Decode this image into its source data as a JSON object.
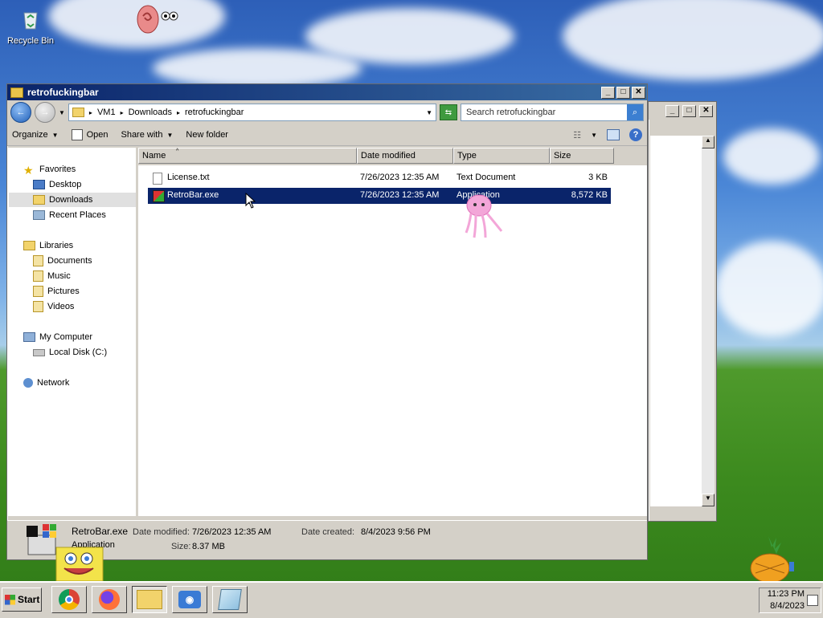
{
  "desktop": {
    "recycle_bin_label": "Recycle Bin"
  },
  "window": {
    "title": "retrofuckingbar",
    "minimize": "_",
    "maximize": "□",
    "close": "✕",
    "address": {
      "crumbs": [
        "VM1",
        "Downloads",
        "retrofuckingbar"
      ],
      "search_placeholder": "Search retrofuckingbar"
    },
    "commands": {
      "organize": "Organize",
      "open": "Open",
      "share_with": "Share with",
      "new_folder": "New folder"
    },
    "nav": {
      "favorites": "Favorites",
      "desktop": "Desktop",
      "downloads": "Downloads",
      "recent_places": "Recent Places",
      "libraries": "Libraries",
      "documents": "Documents",
      "music": "Music",
      "pictures": "Pictures",
      "videos": "Videos",
      "my_computer": "My Computer",
      "local_disk": "Local Disk (C:)",
      "network": "Network"
    },
    "columns": {
      "name": "Name",
      "date_modified": "Date modified",
      "type": "Type",
      "size": "Size"
    },
    "files": [
      {
        "name": "License.txt",
        "date": "7/26/2023 12:35 AM",
        "type": "Text Document",
        "size": "3 KB"
      },
      {
        "name": "RetroBar.exe",
        "date": "7/26/2023 12:35 AM",
        "type": "Application",
        "size": "8,572 KB"
      }
    ],
    "details": {
      "name": "RetroBar.exe",
      "kind": "Application",
      "date_modified_label": "Date modified:",
      "date_modified": "7/26/2023 12:35 AM",
      "date_created_label": "Date created:",
      "date_created": "8/4/2023 9:56 PM",
      "size_label": "Size:",
      "size": "8.37 MB"
    }
  },
  "taskbar": {
    "start_label": "Start",
    "time": "11:23 PM",
    "date": "8/4/2023"
  },
  "colors": {
    "selection": "#0a246a",
    "titlebar": "#0a246a",
    "face": "#d4d0c8"
  }
}
